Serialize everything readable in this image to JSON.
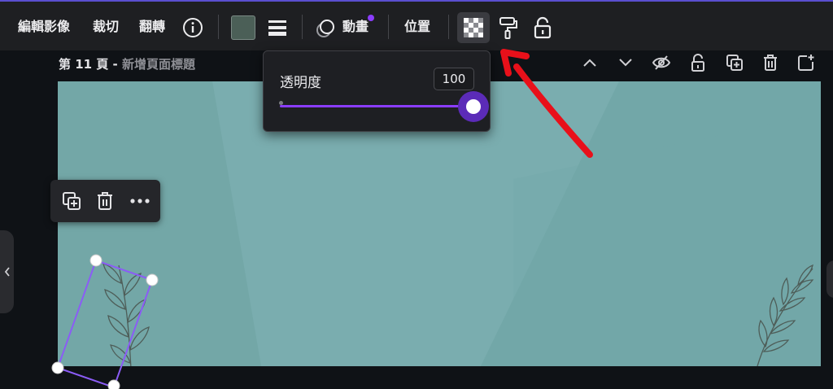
{
  "toolbar": {
    "edit_image": "編輯影像",
    "crop": "裁切",
    "flip": "翻轉",
    "animate": "動畫",
    "position": "位置",
    "swatch_color": "#4b5f57",
    "accent": "#8b3dff",
    "icons": [
      "info-icon",
      "line-weight-icon",
      "animate-icon",
      "transparency-icon",
      "paint-roller-icon",
      "unlock-icon"
    ]
  },
  "page": {
    "title_prefix": "第 11 頁 - ",
    "title_placeholder": "新增頁面標題",
    "actions": [
      "chevron-up-icon",
      "chevron-down-icon",
      "hide-eye-icon",
      "unlock-icon",
      "duplicate-page-icon",
      "trash-icon",
      "add-page-icon"
    ]
  },
  "float_toolbar": {
    "icons": [
      "duplicate-icon",
      "trash-icon",
      "more-icon"
    ]
  },
  "transparency": {
    "label": "透明度",
    "value": "100",
    "level": 1.0
  },
  "canvas": {
    "background": "#75a9aa"
  }
}
